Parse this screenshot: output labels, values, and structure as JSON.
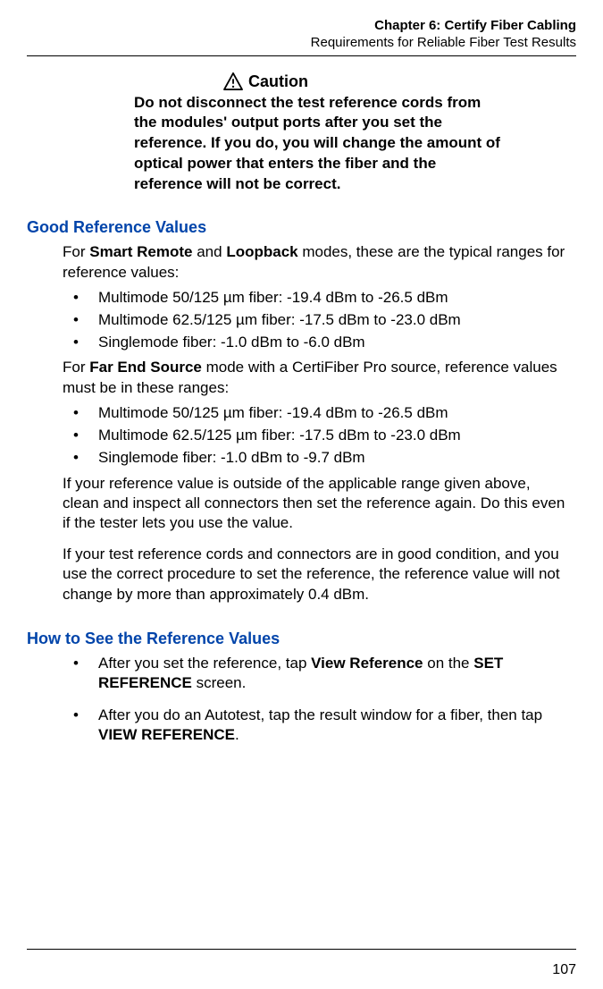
{
  "header": {
    "chapter": "Chapter 6: Certify Fiber Cabling",
    "section": "Requirements for Reliable Fiber Test Results"
  },
  "caution": {
    "label": "Caution",
    "text": "Do not disconnect the test reference cords from the modules' output ports after you set the reference. If you do, you will change the amount of optical power that enters the fiber and the reference will not be correct."
  },
  "s1": {
    "heading": "Good Reference Values",
    "intro_a": "For ",
    "intro_b1": "Smart Remote",
    "intro_c": " and ",
    "intro_b2": "Loopback",
    "intro_d": " modes, these are the typical ranges for reference values:",
    "list1": {
      "i0": "Multimode 50/125 µm fiber: -19.4 dBm to -26.5 dBm",
      "i1": "Multimode 62.5/125 µm fiber: -17.5 dBm to -23.0 dBm",
      "i2": "Singlemode fiber: -1.0 dBm to -6.0 dBm"
    },
    "intro2_a": "For ",
    "intro2_b": "Far End Source",
    "intro2_c": " mode with a CertiFiber Pro source, reference values must be in these ranges:",
    "list2": {
      "i0": "Multimode 50/125 µm fiber: -19.4 dBm to -26.5 dBm",
      "i1": "Multimode 62.5/125 µm fiber: -17.5 dBm to -23.0 dBm",
      "i2": "Singlemode fiber: -1.0 dBm to -9.7 dBm"
    },
    "para1": "If your reference value is outside of the applicable range given above, clean and inspect all connectors then set the reference again. Do this even if the tester lets you use the value.",
    "para2": "If your test reference cords and connectors are in good condition, and you use the correct procedure to set the reference, the reference value will not change by more than approximately 0.4 dBm."
  },
  "s2": {
    "heading": "How to See the Reference Values",
    "item1_a": "After you set the reference, tap ",
    "item1_b1": "View Reference",
    "item1_c": " on the ",
    "item1_b2": "SET REFERENCE",
    "item1_d": " screen.",
    "item2_a": "After you do an Autotest, tap the result window for a fiber, then tap ",
    "item2_b": "VIEW REFERENCE",
    "item2_c": "."
  },
  "page_number": "107"
}
